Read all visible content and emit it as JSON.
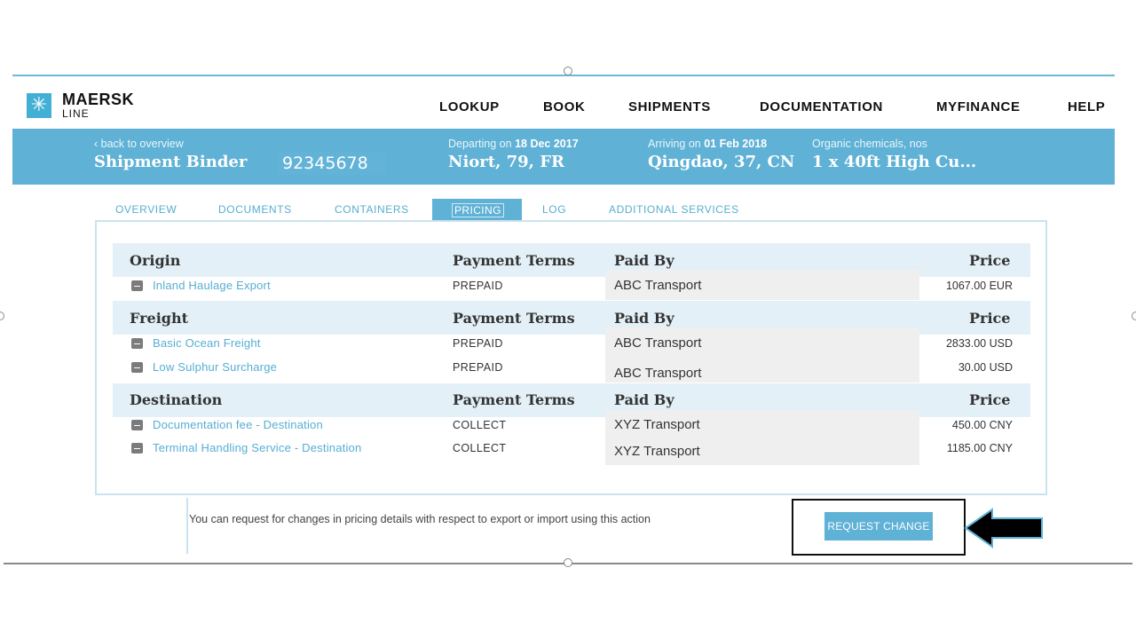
{
  "brand": {
    "name": "MAERSK",
    "sub": "LINE",
    "icon": "star-icon"
  },
  "nav": [
    "LOOKUP",
    "BOOK",
    "SHIPMENTS",
    "DOCUMENTATION",
    "MYFINANCE",
    "HELP"
  ],
  "shipment": {
    "back_link": "back to overview",
    "title": "Shipment Binder",
    "id": "92345678",
    "departing_label": "Departing on",
    "departing_date": "18 Dec 2017",
    "departing_place": "Niort, 79, FR",
    "arriving_label": "Arriving on",
    "arriving_date": "01 Feb 2018",
    "arriving_place": "Qingdao, 37, CN",
    "commodity": "Organic chemicals, nos",
    "container": "1 x 40ft High Cu..."
  },
  "tabs": [
    "OVERVIEW",
    "DOCUMENTS",
    "CONTAINERS",
    "PRICING",
    "LOG",
    "ADDITIONAL SERVICES"
  ],
  "active_tab": "PRICING",
  "columns": {
    "terms": "Payment Terms",
    "paid_by": "Paid By",
    "price": "Price"
  },
  "groups": [
    {
      "name": "Origin",
      "rows": [
        {
          "name": "Inland Haulage Export",
          "terms": "PREPAID",
          "paid_by": "ABC Transport",
          "price": "1067.00 EUR"
        }
      ]
    },
    {
      "name": "Freight",
      "rows": [
        {
          "name": "Basic Ocean Freight",
          "terms": "PREPAID",
          "paid_by": "ABC Transport",
          "price": "2833.00 USD"
        },
        {
          "name": "Low Sulphur Surcharge",
          "terms": "PREPAID",
          "paid_by": "ABC Transport",
          "price": "30.00 USD"
        }
      ]
    },
    {
      "name": "Destination",
      "rows": [
        {
          "name": "Documentation fee - Destination",
          "terms": "COLLECT",
          "paid_by": "XYZ Transport",
          "price": "450.00 CNY"
        },
        {
          "name": "Terminal Handling Service - Destination",
          "terms": "COLLECT",
          "paid_by": "XYZ Transport",
          "price": "1185.00 CNY"
        }
      ]
    }
  ],
  "action": {
    "text": "You can request for changes in pricing details with respect to export or import using this action",
    "button": "REQUEST CHANGE"
  },
  "colors": {
    "brand_blue": "#5fb1d5",
    "link_blue": "#56aed3",
    "header_row": "#e3f0f7"
  }
}
